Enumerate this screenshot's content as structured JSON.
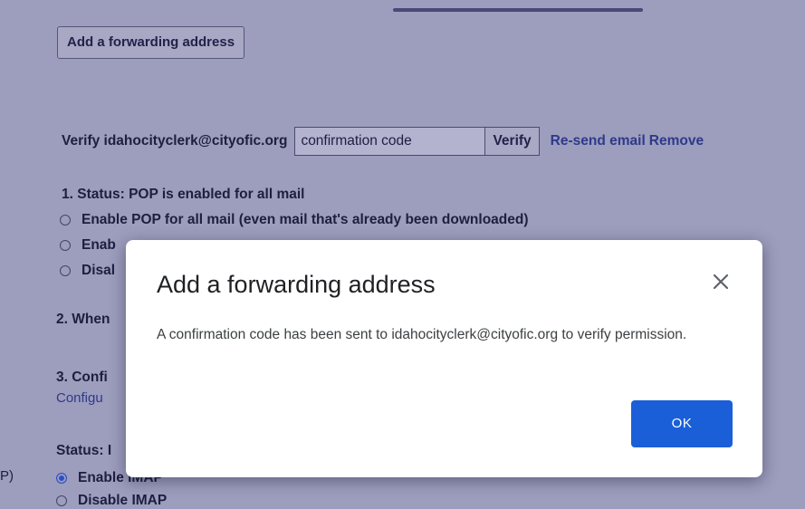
{
  "background": {
    "add_forwarding_button": "Add a forwarding address",
    "verify": {
      "label": "Verify idahocityclerk@cityofic.org",
      "code_value": "confirmation code",
      "verify_button": "Verify",
      "resend_link": "Re-send email",
      "remove_link": "Remove"
    },
    "pop": {
      "status": "1. Status: POP is enabled for all mail",
      "options": [
        "Enable POP for all mail (even mail that's already been downloaded)",
        "Enab",
        "Disal"
      ]
    },
    "section2": "2. When",
    "section3": "3. Confi",
    "configure_link": "Configu",
    "imap": {
      "status": "Status: I",
      "left_fragment": "P)",
      "options": [
        "Enable IMAP",
        "Disable IMAP"
      ]
    }
  },
  "dialog": {
    "title": "Add a forwarding address",
    "message": "A confirmation code has been sent to idahocityclerk@cityofic.org to verify permission.",
    "ok_label": "OK"
  },
  "colors": {
    "overlay": "#9d9dbd",
    "primary_button": "#1a5fd8",
    "link": "#2d3a8c"
  },
  "icons": {
    "close": "close-icon"
  }
}
